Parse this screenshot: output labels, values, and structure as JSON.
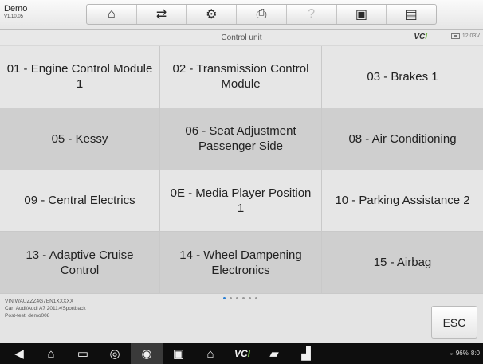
{
  "header": {
    "app_name": "Demo",
    "app_version": "V1.10.05",
    "toolbar": [
      {
        "icon": "home-icon",
        "glyph": "⌂",
        "enabled": true
      },
      {
        "icon": "vehicle-swap-icon",
        "glyph": "⇄",
        "enabled": true
      },
      {
        "icon": "settings-gear-icon",
        "glyph": "⚙",
        "enabled": true
      },
      {
        "icon": "print-icon",
        "glyph": "⎙",
        "enabled": true
      },
      {
        "icon": "help-icon",
        "glyph": "?",
        "enabled": false
      },
      {
        "icon": "save-icon",
        "glyph": "▣",
        "enabled": true
      },
      {
        "icon": "message-icon",
        "glyph": "▤",
        "enabled": true
      }
    ]
  },
  "subheader": {
    "title": "Control unit",
    "vci_label_main": "VC",
    "vci_label_accent": "I",
    "battery_voltage": "12.03V"
  },
  "control_units": [
    {
      "label": "01 - Engine Control Module 1"
    },
    {
      "label": "02 - Transmission Control Module"
    },
    {
      "label": "03 - Brakes 1"
    },
    {
      "label": "05 - Kessy"
    },
    {
      "label": "06 - Seat Adjustment Passenger Side"
    },
    {
      "label": "08 - Air Conditioning"
    },
    {
      "label": "09 - Central Electrics"
    },
    {
      "label": "0E - Media Player Position 1"
    },
    {
      "label": "10 - Parking Assistance 2"
    },
    {
      "label": "13 - Adaptive Cruise Control"
    },
    {
      "label": "14 - Wheel Dampening Electronics"
    },
    {
      "label": "15 - Airbag"
    }
  ],
  "footer": {
    "vin": "VIN:WAUZZZ4G7EN1XXXXX",
    "car": "Car: Audi/Audi A7 2011>/Sportback",
    "post_test": "Post-test: demo008",
    "page_count": 6,
    "active_page": 0,
    "esc_label": "ESC"
  },
  "navbar": {
    "battery_percent": "96%",
    "time": "8:0"
  }
}
